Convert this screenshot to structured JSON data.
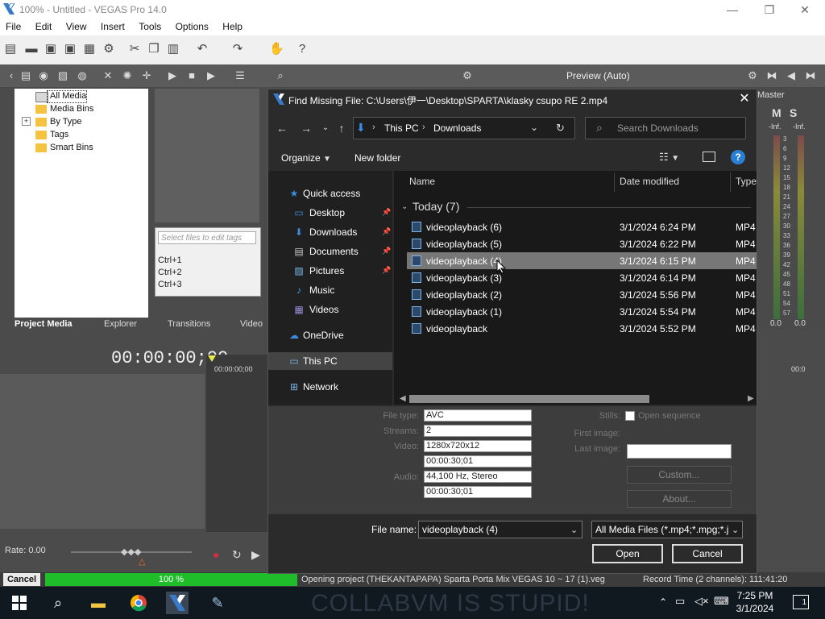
{
  "window": {
    "title": "100% - Untitled - VEGAS Pro 14.0",
    "menu": [
      "File",
      "Edit",
      "View",
      "Insert",
      "Tools",
      "Options",
      "Help"
    ]
  },
  "preview": {
    "label": "Preview (Auto)",
    "master": "Master"
  },
  "project_media": {
    "tree": [
      "All Media",
      "Media Bins",
      "By Type",
      "Tags",
      "Smart Bins"
    ],
    "tags_placeholder": "Select files to edit tags",
    "shortcuts": [
      "Ctrl+1",
      "Ctrl+2",
      "Ctrl+3"
    ],
    "tabs": [
      "Project Media",
      "Explorer",
      "Transitions",
      "Video"
    ]
  },
  "timeline": {
    "timecode": "00:00:00;00",
    "ruler_start": "00:00:00;00",
    "ruler_end": "00:0",
    "rate": "Rate: 0.00"
  },
  "meters": {
    "labels": [
      "-Inf.",
      "-Inf."
    ],
    "scale": [
      "3",
      "6",
      "9",
      "12",
      "15",
      "18",
      "21",
      "24",
      "27",
      "30",
      "33",
      "36",
      "39",
      "42",
      "45",
      "48",
      "51",
      "54",
      "57"
    ],
    "bottom": [
      "0.0",
      "0.0"
    ]
  },
  "statusbar": {
    "cancel": "Cancel",
    "progress_text": "100 %",
    "progress_value": 100,
    "message": "Opening project (THEKANTAPAPA) Sparta Porta Mix VEGAS 10 ~ 17 (1).veg",
    "record_time": "Record Time (2 channels): 111:41:20"
  },
  "taskbar": {
    "time": "7:25 PM",
    "date": "3/1/2024",
    "watermark": "COLLABVM IS STUPID!",
    "notification_count": "1"
  },
  "dialog": {
    "title": "Find Missing File: C:\\Users\\伊一\\Desktop\\SPARTA\\klasky csupo RE 2.mp4",
    "breadcrumb": [
      "This PC",
      "Downloads"
    ],
    "search_placeholder": "Search Downloads",
    "organize": "Organize",
    "new_folder": "New folder",
    "nav": [
      {
        "label": "Quick access",
        "icon": "star-icon",
        "pinned": false
      },
      {
        "label": "Desktop",
        "icon": "desktop-icon",
        "pinned": true
      },
      {
        "label": "Downloads",
        "icon": "download-arrow-icon",
        "pinned": true
      },
      {
        "label": "Documents",
        "icon": "document-icon",
        "pinned": true
      },
      {
        "label": "Pictures",
        "icon": "picture-icon",
        "pinned": true
      },
      {
        "label": "Music",
        "icon": "music-note-icon",
        "pinned": false
      },
      {
        "label": "Videos",
        "icon": "video-icon",
        "pinned": false
      },
      {
        "label": "OneDrive",
        "icon": "cloud-icon",
        "pinned": false
      },
      {
        "label": "This PC",
        "icon": "computer-icon",
        "pinned": false
      },
      {
        "label": "Network",
        "icon": "network-icon",
        "pinned": false
      }
    ],
    "columns": [
      "Name",
      "Date modified",
      "Type"
    ],
    "group": "Today (7)",
    "files": [
      {
        "name": "videoplayback (6)",
        "date": "3/1/2024 6:24 PM",
        "type": "MP4"
      },
      {
        "name": "videoplayback (5)",
        "date": "3/1/2024 6:22 PM",
        "type": "MP4"
      },
      {
        "name": "videoplayback (4)",
        "date": "3/1/2024 6:15 PM",
        "type": "MP4"
      },
      {
        "name": "videoplayback (3)",
        "date": "3/1/2024 6:14 PM",
        "type": "MP4"
      },
      {
        "name": "videoplayback (2)",
        "date": "3/1/2024 5:56 PM",
        "type": "MP4"
      },
      {
        "name": "videoplayback (1)",
        "date": "3/1/2024 5:54 PM",
        "type": "MP4"
      },
      {
        "name": "videoplayback",
        "date": "3/1/2024 5:52 PM",
        "type": "MP4"
      }
    ],
    "selected_index": 2,
    "info": {
      "file_type_label": "File type:",
      "file_type": "AVC",
      "streams_label": "Streams:",
      "streams": "2",
      "video_label": "Video:",
      "video": "1280x720x12",
      "video_duration": "00:00:30;01",
      "audio_label": "Audio:",
      "audio": "44,100 Hz, Stereo",
      "audio_duration": "00:00:30;01",
      "stills_label": "Stills:",
      "open_sequence": "Open sequence",
      "first_image_label": "First image:",
      "last_image_label": "Last image:",
      "custom_btn": "Custom...",
      "about_btn": "About..."
    },
    "file_name_label": "File name:",
    "file_name_value": "videoplayback (4)",
    "filter": "All Media Files (*.mp4;*.mpg;*.j",
    "open_btn": "Open",
    "cancel_btn": "Cancel"
  }
}
